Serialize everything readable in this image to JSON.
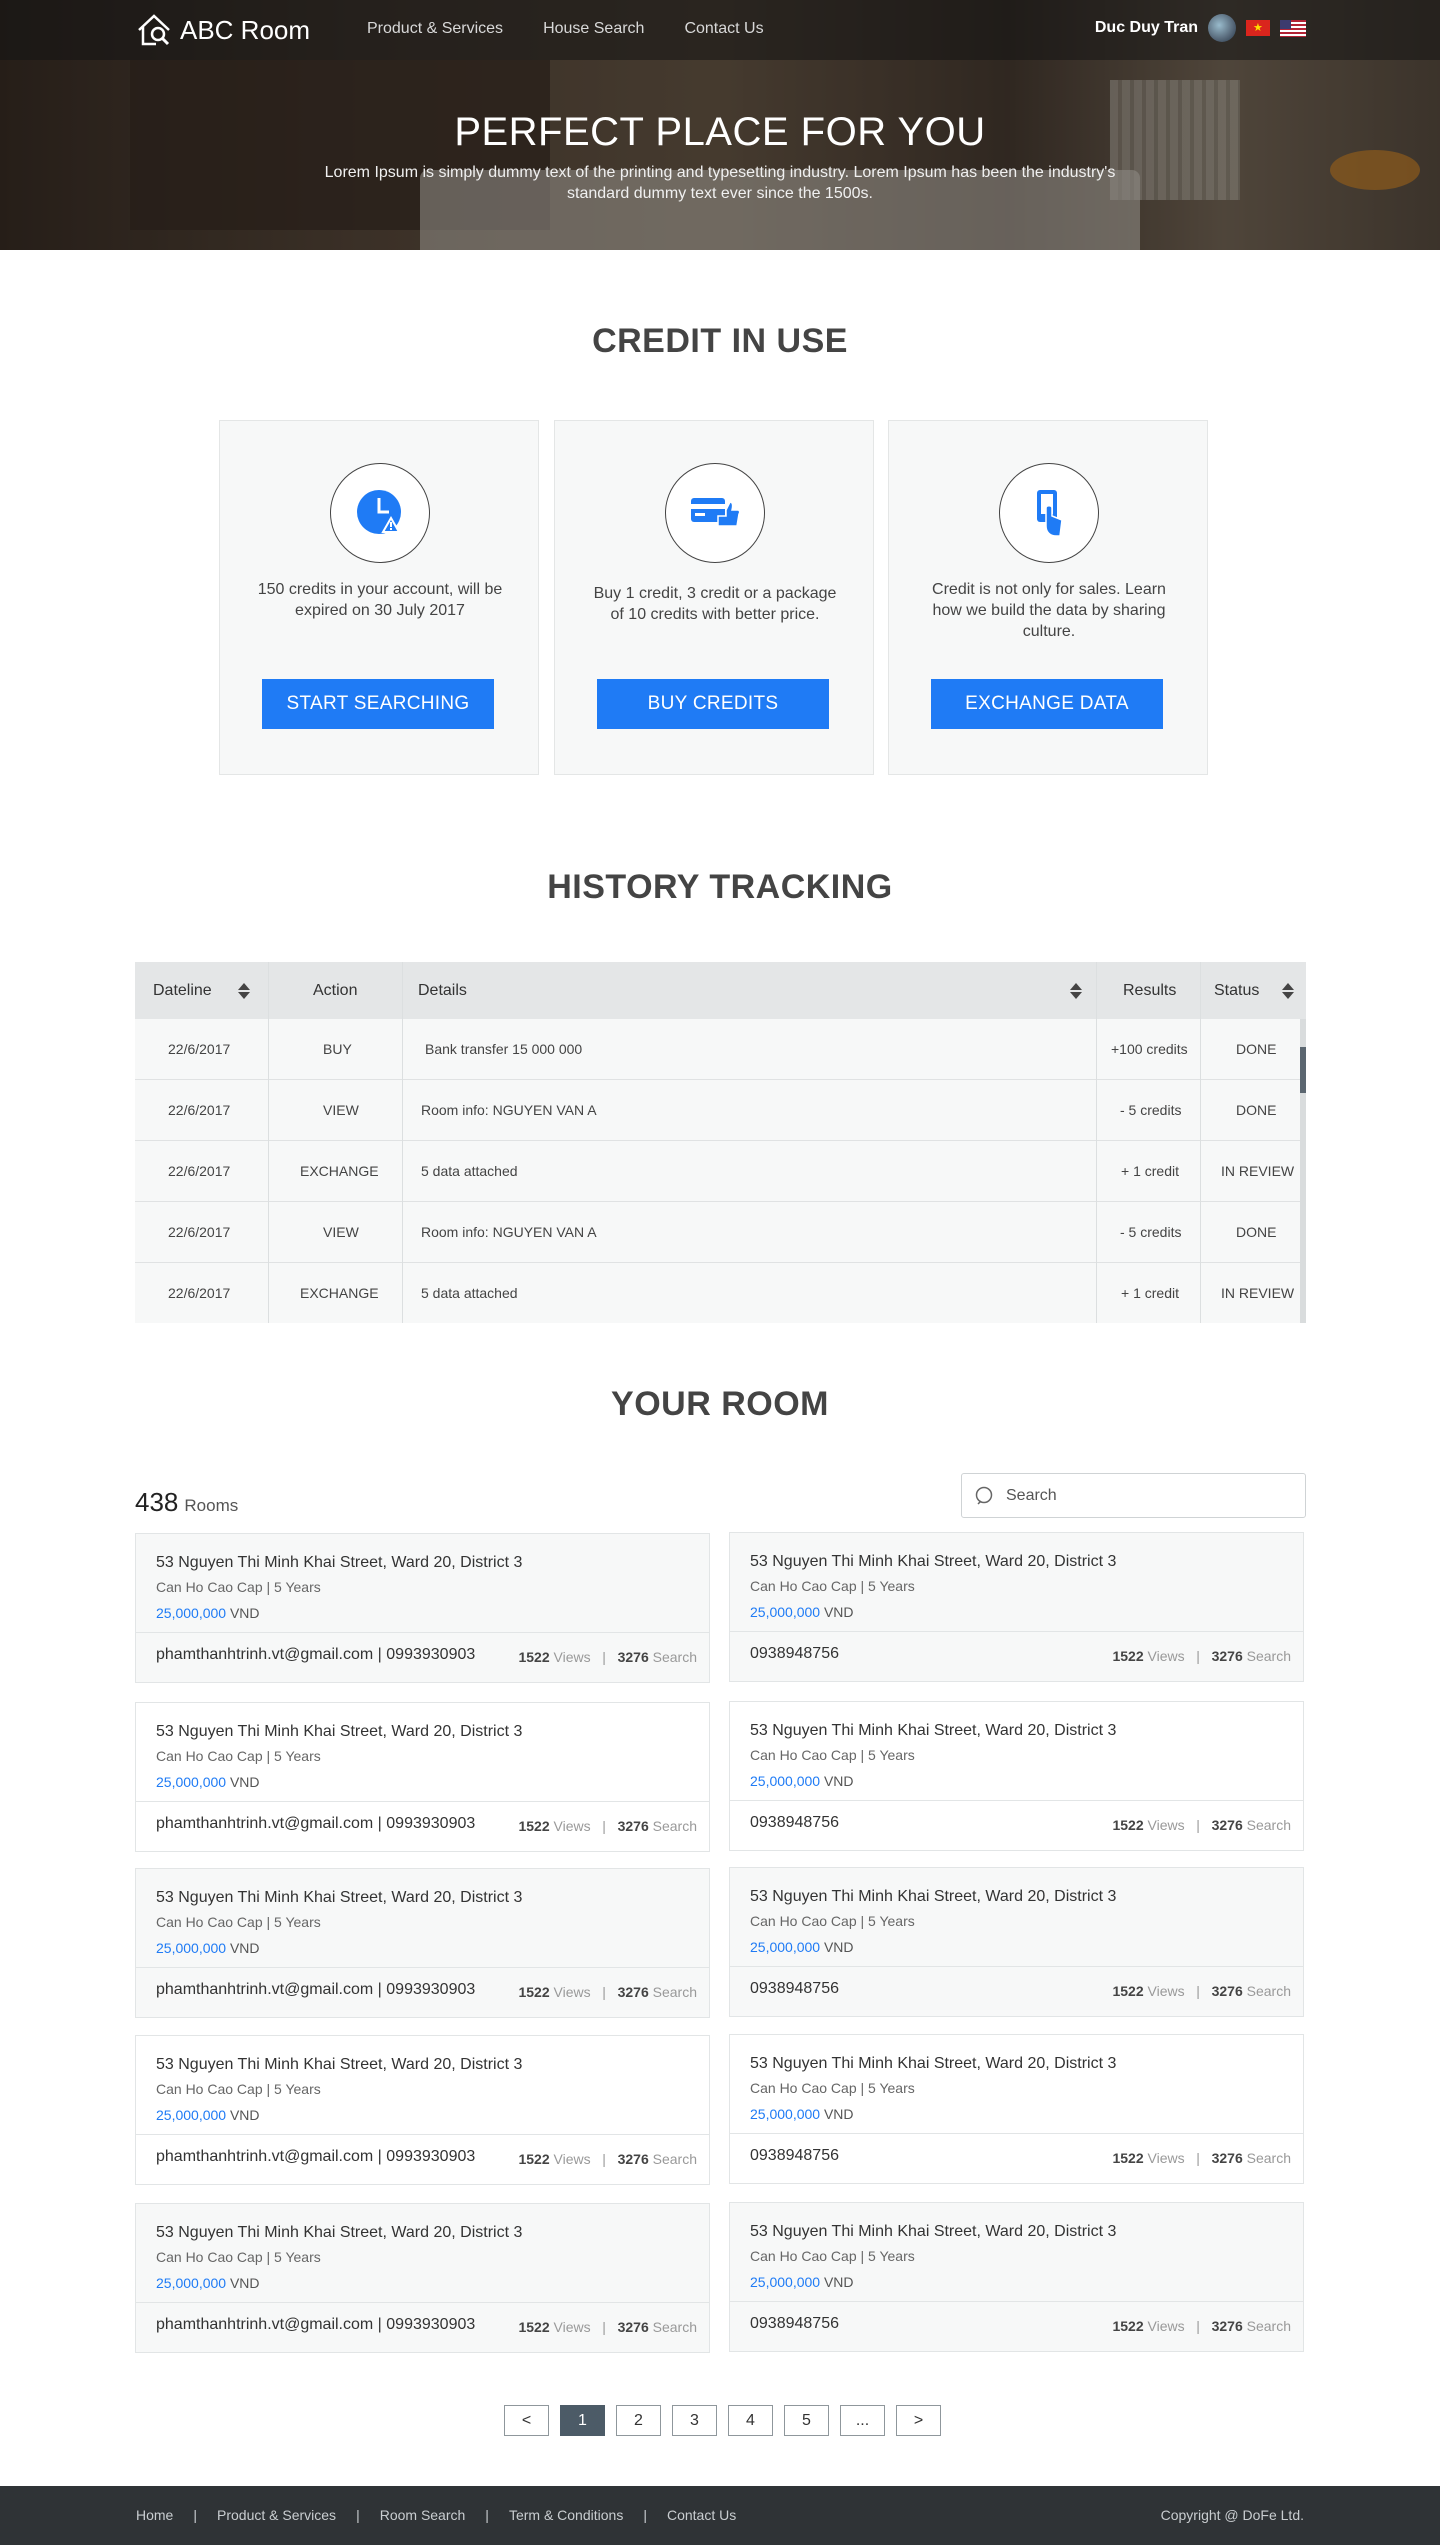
{
  "header": {
    "brand": "ABC Room",
    "nav": [
      "Product &  Services",
      "House Search",
      "Contact Us"
    ],
    "user_name": "Duc Duy Tran"
  },
  "hero": {
    "title": "PERFECT PLACE FOR YOU",
    "subtitle": "Lorem Ipsum is simply dummy text of the printing and typesetting industry. Lorem Ipsum has been the industry's standard dummy text ever since the 1500s."
  },
  "credit": {
    "title": "CREDIT IN USE",
    "cards": [
      {
        "icon": "clock-warning-icon",
        "text": "150 credits in your account, will be expired on 30 July 2017",
        "button": "START  SEARCHING"
      },
      {
        "icon": "credit-card-thumbs-up-icon",
        "text": "Buy 1 credit, 3 credit or a package of 10 credits with better price.",
        "button": "BUY CREDITS"
      },
      {
        "icon": "hand-phone-icon",
        "text": "Credit is not only for sales. Learn how we build the data by sharing culture.",
        "button": "EXCHANGE DATA"
      }
    ]
  },
  "history": {
    "title": "HISTORY TRACKING",
    "columns": [
      "Dateline",
      "Action",
      "Details",
      "Results",
      "Status"
    ],
    "rows": [
      {
        "date": "22/6/2017",
        "action": "BUY",
        "details": "Bank transfer 15 000 000",
        "result": "+100 credits",
        "status": "DONE"
      },
      {
        "date": "22/6/2017",
        "action": "VIEW",
        "details": "Room info: NGUYEN VAN A",
        "result": "- 5 credits",
        "status": "DONE"
      },
      {
        "date": "22/6/2017",
        "action": "EXCHANGE",
        "details": "5 data attached",
        "result": "+ 1 credit",
        "status": "IN REVIEW"
      },
      {
        "date": "22/6/2017",
        "action": "VIEW",
        "details": "Room info: NGUYEN VAN A",
        "result": "- 5 credits",
        "status": "DONE"
      },
      {
        "date": "22/6/2017",
        "action": "EXCHANGE",
        "details": "5 data attached",
        "result": "+ 1 credit",
        "status": "IN REVIEW"
      }
    ]
  },
  "rooms": {
    "title": "YOUR ROOM",
    "count": "438",
    "count_label": "Rooms",
    "search_placeholder": "Search",
    "address": "53 Nguyen Thi Minh Khai Street,  Ward 20, District 3",
    "meta": "Can Ho Cao Cap  |  5 Years",
    "price": "25,000,000",
    "currency": "VND",
    "contact_left": "phamthanhtrinh.vt@gmail.com  |  0993930903",
    "contact_right": "0938948756",
    "views": "1522",
    "views_label": "Views",
    "searches": "3276",
    "search_label": "Search",
    "stats_sep": "|"
  },
  "pagination": [
    "<",
    "1",
    "2",
    "3",
    "4",
    "5",
    "...",
    ">"
  ],
  "footer": {
    "links": [
      "Home",
      "Product & Services",
      "Room  Search",
      "Term & Conditions",
      "Contact Us"
    ],
    "separator": "|",
    "copyright": "Copyright @ DoFe Ltd."
  },
  "colors": {
    "accent": "#1f7bf5",
    "footer": "#2f3336",
    "active_page": "#4c5b67"
  }
}
